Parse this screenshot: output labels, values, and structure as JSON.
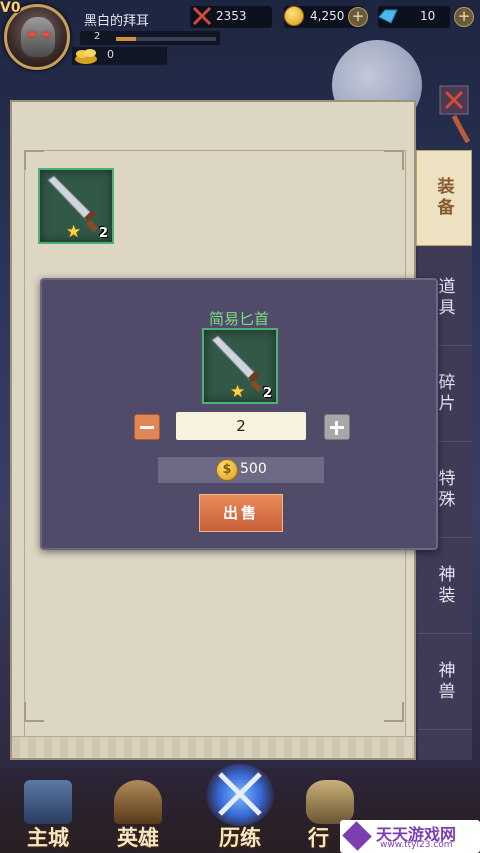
{
  "player": {
    "vip": "V0",
    "name": "黑白的拜耳",
    "level": "2",
    "secondary_value": "0",
    "level_progress": 0.2
  },
  "resources": {
    "power": "2353",
    "gold": "4,250",
    "gems": "10"
  },
  "panel": {
    "item": {
      "count": "2",
      "star": "★"
    }
  },
  "tabs": [
    {
      "label": "装备",
      "active": true
    },
    {
      "label": "道具"
    },
    {
      "label": "碎片"
    },
    {
      "label": "特殊"
    },
    {
      "label": "神装"
    },
    {
      "label": "神兽"
    }
  ],
  "modal": {
    "title": "简易匕首",
    "item_count": "2",
    "quantity": "2",
    "price": "500",
    "coin_symbol": "$",
    "sell_label": "出售"
  },
  "nav": [
    {
      "label": "主城",
      "icon": "castle-icon"
    },
    {
      "label": "英雄",
      "icon": "hero-icon"
    },
    {
      "label": "历练",
      "icon": "crossed-swords-icon"
    },
    {
      "label": "行",
      "icon": "bag-icon"
    }
  ],
  "watermark": {
    "text": "天天游戏网",
    "sub": "www.ttyl23.com"
  },
  "colors": {
    "item_frame": "#4fb077",
    "item_title": "#7ee07e",
    "sell_button": "#e08656",
    "parchment": "#ddd6c3",
    "tab_active": "#ece2c2"
  }
}
